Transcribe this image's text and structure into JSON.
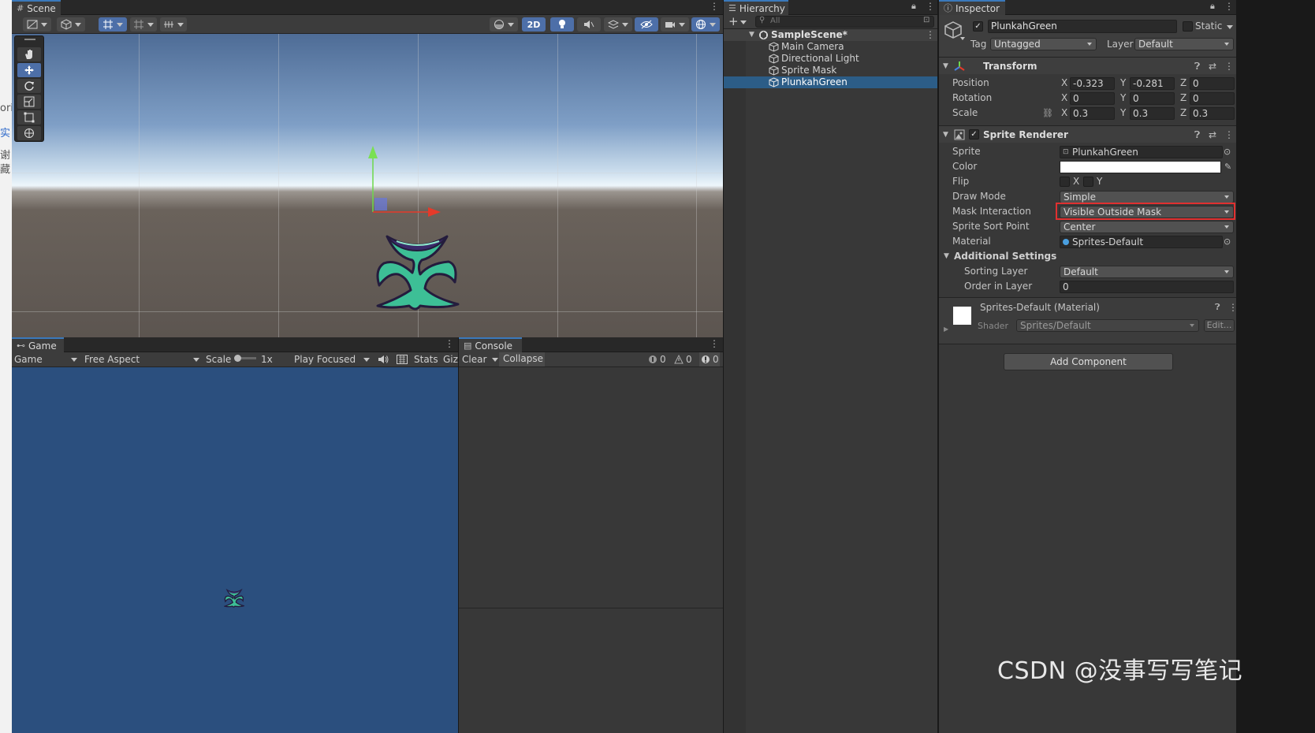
{
  "left_strip": {
    "chars": [
      "ori",
      "实",
      "谢",
      "藏"
    ]
  },
  "scene": {
    "tab_label": "Scene",
    "toolbar": {
      "mode_2d": "2D"
    }
  },
  "game": {
    "tab_label": "Game",
    "display_dropdown": "Game",
    "aspect_dropdown": "Free Aspect",
    "scale_label": "Scale",
    "scale_value": "1x",
    "play_mode_dropdown": "Play Focused",
    "stats_label": "Stats",
    "gizmos_label": "Giz"
  },
  "console": {
    "tab_label": "Console",
    "clear_label": "Clear",
    "collapse_label": "Collapse",
    "log_count": "0",
    "warning_count": "0",
    "error_count": "0"
  },
  "hierarchy": {
    "tab_label": "Hierarchy",
    "search_placeholder": "All",
    "scene_name": "SampleScene*",
    "items": [
      {
        "label": "Main Camera"
      },
      {
        "label": "Directional Light"
      },
      {
        "label": "Sprite Mask"
      },
      {
        "label": "PlunkahGreen",
        "selected": true
      }
    ]
  },
  "inspector": {
    "tab_label": "Inspector",
    "object_name": "PlunkahGreen",
    "static_label": "Static",
    "tag_label": "Tag",
    "tag_value": "Untagged",
    "layer_label": "Layer",
    "layer_value": "Default",
    "transform": {
      "title": "Transform",
      "position_label": "Position",
      "rotation_label": "Rotation",
      "scale_label": "Scale",
      "position": {
        "x": "-0.323",
        "y": "-0.281",
        "z": "0"
      },
      "rotation": {
        "x": "0",
        "y": "0",
        "z": "0"
      },
      "scale": {
        "x": "0.3",
        "y": "0.3",
        "z": "0.3"
      }
    },
    "sprite_renderer": {
      "title": "Sprite Renderer",
      "sprite_label": "Sprite",
      "sprite_value": "PlunkahGreen",
      "color_label": "Color",
      "color_value": "#ffffff",
      "flip_label": "Flip",
      "flip_x": "X",
      "flip_y": "Y",
      "draw_mode_label": "Draw Mode",
      "draw_mode_value": "Simple",
      "mask_interaction_label": "Mask Interaction",
      "mask_interaction_value": "Visible Outside Mask",
      "sort_point_label": "Sprite Sort Point",
      "sort_point_value": "Center",
      "material_label": "Material",
      "material_value": "Sprites-Default",
      "additional_settings_label": "Additional Settings",
      "sorting_layer_label": "Sorting Layer",
      "sorting_layer_value": "Default",
      "order_in_layer_label": "Order in Layer",
      "order_in_layer_value": "0"
    },
    "material": {
      "title": "Sprites-Default (Material)",
      "shader_label": "Shader",
      "shader_value": "Sprites/Default",
      "edit_label": "Edit..."
    },
    "add_component_label": "Add Component"
  },
  "watermark": "CSDN @没事写写笔记",
  "colors": {
    "accent_blue": "#3a79bb",
    "selection": "#2c5d87",
    "highlight_red": "#e03030",
    "game_bg": "#2b4f7e",
    "plant_teal": "#3dbf96",
    "plant_purple": "#3a2a6a"
  }
}
